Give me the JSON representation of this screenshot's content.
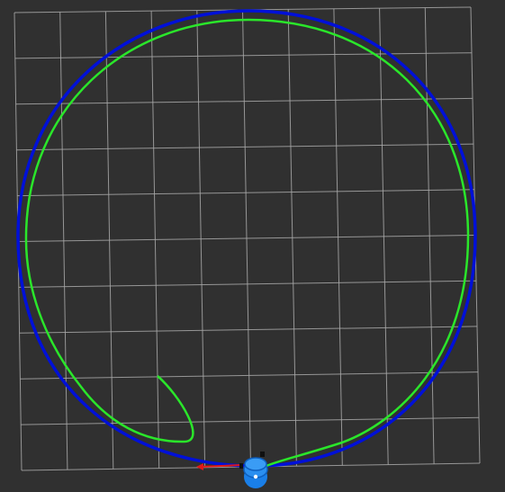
{
  "scene": {
    "background_color": "#303030",
    "grid_color": "#a8a8a8",
    "grid_cells": [
      10,
      10
    ],
    "reference_path": {
      "name": "reference-circle-path",
      "color": "#0010d8"
    },
    "trajectory_path": {
      "name": "robot-trajectory-path",
      "color": "#2ae62a"
    },
    "heading_arrow": {
      "color": "#e01818"
    },
    "robot": {
      "color": "#1a7fe8",
      "icon": "robot-marker-icon"
    }
  }
}
